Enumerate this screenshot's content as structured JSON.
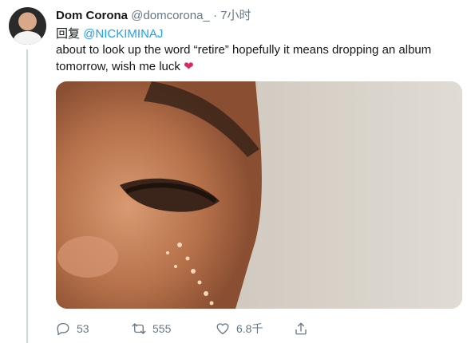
{
  "tweet": {
    "author_name": "Dom Corona",
    "handle": "@domcorona_",
    "separator": "·",
    "time": "7小时",
    "reply_prefix": "回复",
    "reply_mention": "@NICKIMINAJ",
    "text": "about to look up the word “retire” hopefully it means dropping an album tomorrow, wish me luck",
    "heart_emoji": "❤",
    "heart_color": "#e0245e"
  },
  "actions": {
    "reply_count": "53",
    "retweet_count": "555",
    "like_count": "6.8千",
    "icon_color": "#657786"
  },
  "icons": [
    "reply-icon",
    "retweet-icon",
    "like-icon",
    "share-icon"
  ],
  "colors": {
    "link": "#1da1f2",
    "thread_line": "#ccd6dd"
  }
}
